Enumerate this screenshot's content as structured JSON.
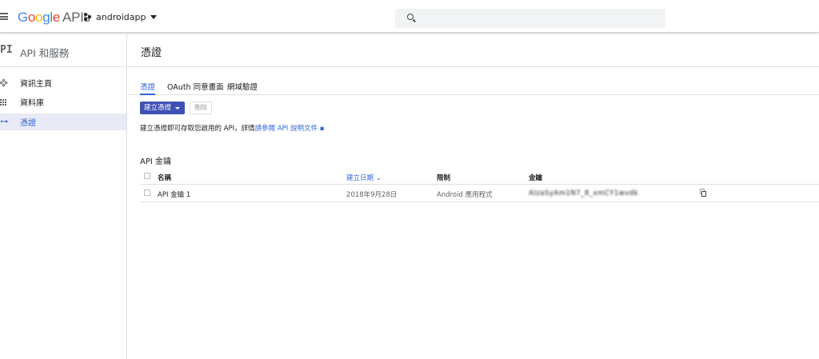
{
  "header": {
    "logo_google": [
      "G",
      "o",
      "o",
      "g",
      "l",
      "e"
    ],
    "logo_apis": "APIs",
    "project_name": "androidapp"
  },
  "sidebar": {
    "mark": "PI",
    "title": "API 和服務",
    "items": [
      {
        "label": "資訊主頁",
        "icon": "dashboard-icon",
        "active": false
      },
      {
        "label": "資料庫",
        "icon": "library-icon",
        "active": false
      },
      {
        "label": "憑證",
        "icon": "key-icon",
        "active": true
      }
    ]
  },
  "main": {
    "title": "憑證",
    "tabs": [
      {
        "label": "憑證",
        "active": true
      },
      {
        "label": "OAuth 同意畫面",
        "active": false
      },
      {
        "label": "網域驗證",
        "active": false
      }
    ],
    "create_button": "建立憑證",
    "delete_button": "刪除",
    "info_prefix": "建立憑證即可存取您啟用的 API，詳情",
    "info_link": "請參閱 API 說明文件",
    "info_suffix": " ▪",
    "section_title": "API 金鑰",
    "columns": {
      "name": "名稱",
      "created": "建立日期",
      "sort_indicator": "⌄",
      "restriction": "限制",
      "key": "金鑰"
    },
    "rows": [
      {
        "name": "API 金鑰 1",
        "created": "2018年9月28日",
        "restriction": "Android 應用程式",
        "key": "AIzaSyAm1N7_8_xmCY1wvdk"
      }
    ]
  },
  "colors": {
    "accent": "#3367d6",
    "button": "#3f51b5",
    "active_nav_bg": "#e8eaf6"
  }
}
